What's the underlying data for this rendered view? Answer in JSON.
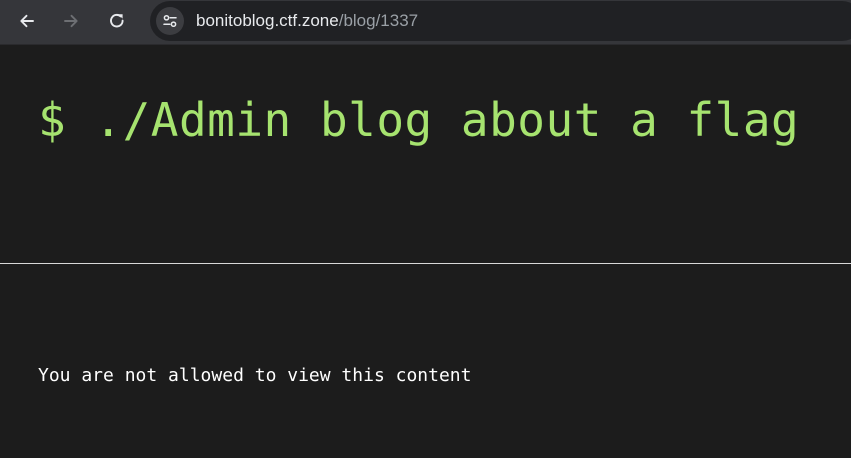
{
  "browser": {
    "url_host": "bonitoblog.ctf.zone",
    "url_path": "/blog/1337",
    "icons": {
      "back": "back-arrow-icon",
      "forward": "forward-arrow-icon",
      "reload": "reload-icon",
      "site_info": "tune-icon"
    },
    "colors": {
      "toolbar_bg": "#35363a",
      "omnibox_bg": "#202124",
      "host_text": "#e8eaed",
      "path_text": "#9aa0a6",
      "icon_active": "#e8eaed",
      "icon_disabled": "#6d6f73"
    }
  },
  "page": {
    "title": "$ ./Admin blog about a flag",
    "message": "You are not allowed to view this content",
    "colors": {
      "background": "#1c1c1c",
      "title": "#a6e36f",
      "message": "#ffffff",
      "divider": "#d8d8d8"
    }
  }
}
